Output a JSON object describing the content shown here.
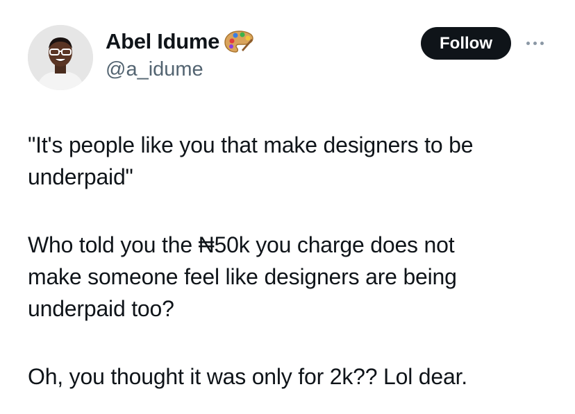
{
  "author": {
    "display_name": "Abel Idume",
    "handle": "@a_idume",
    "badge_icon": "artist-palette-icon",
    "avatar_icon": "profile-photo-avatar"
  },
  "actions": {
    "follow_label": "Follow",
    "more_icon": "more-options-icon"
  },
  "tweet": {
    "paragraphs": [
      {
        "lines": [
          "\"It's people like you that make designers to be",
          "underpaid\""
        ]
      },
      {
        "lines": [
          "Who told you the ₦50k you charge does not",
          "make someone feel like designers are being",
          "underpaid too?"
        ]
      },
      {
        "lines": [
          "Oh, you thought it was only for 2k?? Lol dear."
        ]
      }
    ]
  },
  "colors": {
    "text_primary": "#0f1419",
    "text_secondary": "#536471",
    "button_bg": "#0f1419",
    "button_text": "#ffffff"
  }
}
